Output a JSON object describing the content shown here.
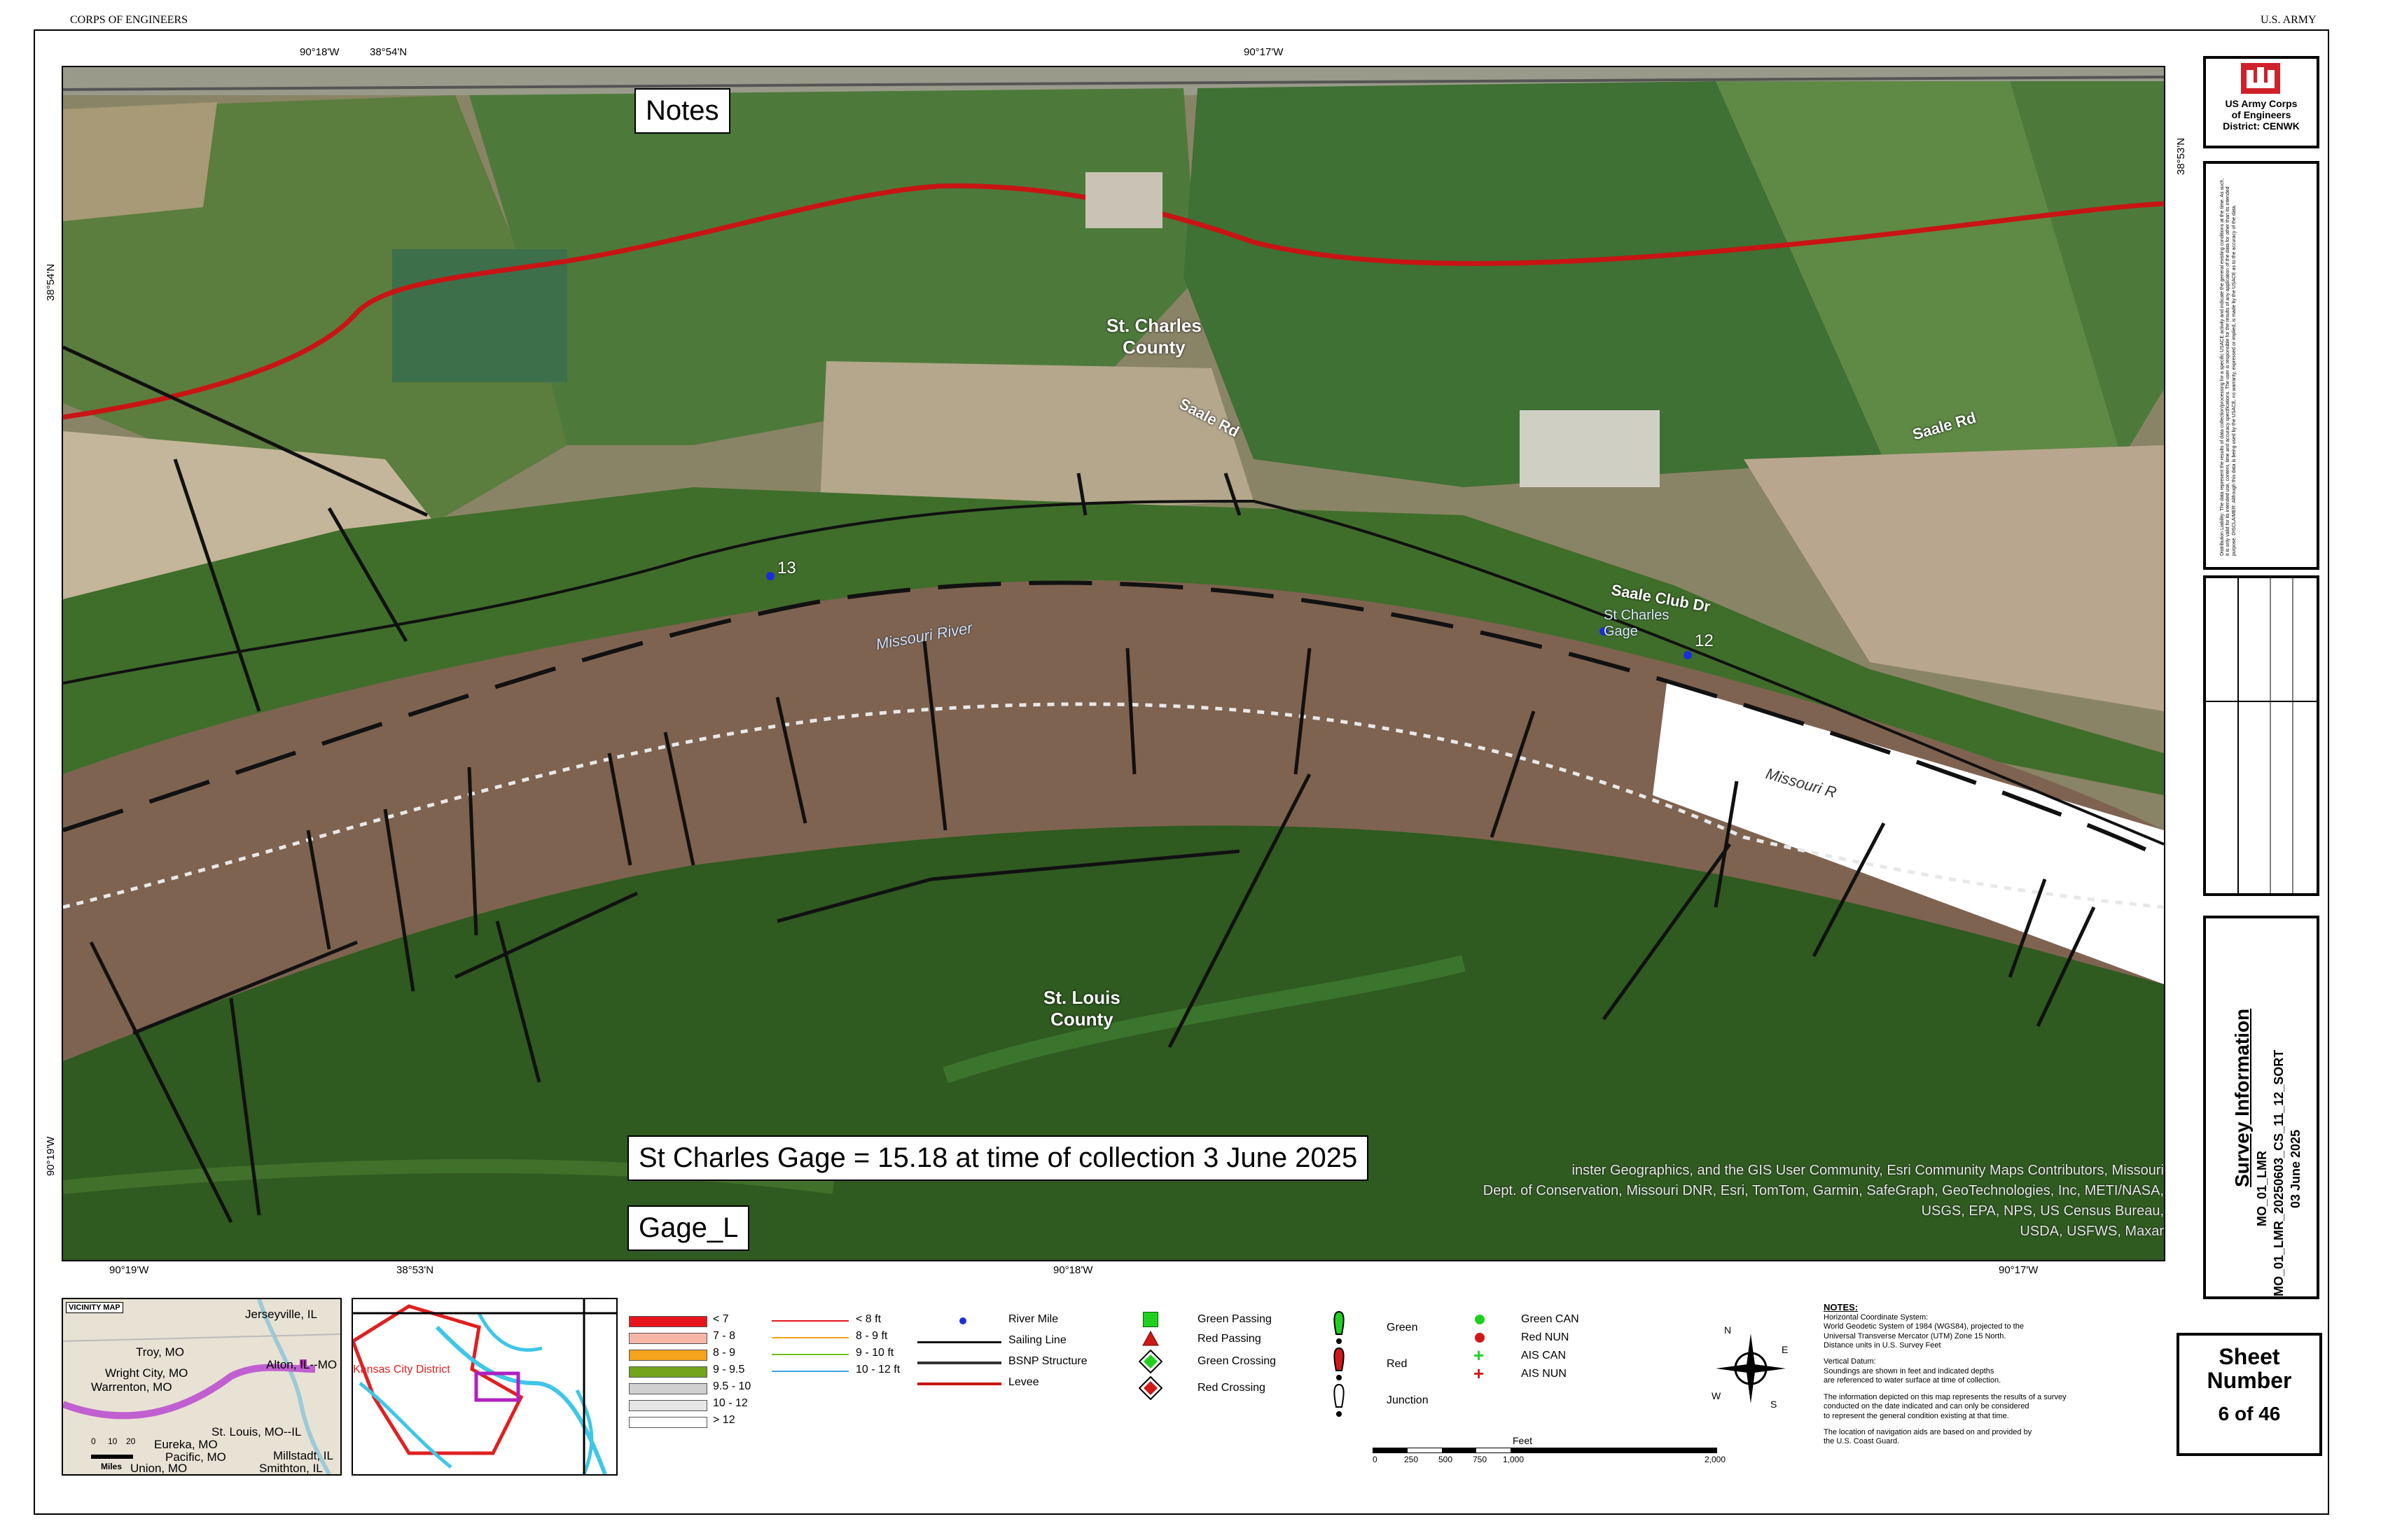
{
  "header": {
    "left": "CORPS OF ENGINEERS",
    "right": "U.S. ARMY"
  },
  "map": {
    "top_ticks": [
      "90°18'W",
      "38°54'N",
      "90°17'W"
    ],
    "bottom_ticks": [
      "90°19'W",
      "38°53'N",
      "90°18'W",
      "90°17'W"
    ],
    "left_ticks": [
      "38°54'N",
      "90°19'W"
    ],
    "right_ticks": [
      "38°53'N"
    ],
    "notes_box": "Notes",
    "gage_box": "St Charles Gage = 15.18 at time of collection 3 June 2025",
    "gage_layer": "Gage_L",
    "labels": {
      "st_charles_county": "St. Charles\nCounty",
      "st_louis_county": "St. Louis\nCounty",
      "missouri_river": "Missouri River",
      "missouri_river_2": "Missouri R",
      "saale_rd_1": "Saale Rd",
      "saale_rd_2": "Saale Rd",
      "saale_club_dr": "Saale Club Dr",
      "st_charles_gage": "St Charles\nGage",
      "river_mile_13": "13",
      "river_mile_12": "12"
    },
    "attribution": "Esri Community Maps Contributors, Missouri Dept. of Conservation, Missouri DNR, Esri, TomTom, Garmin, SafeGraph, GeoTechnologies, Inc, METI/NASA, USGS, EPA, NPS, US Census Bureau, USDA, USFWS, Maxar",
    "attribution_lines": [
      "inster Geographics, and the GIS User Community, Esri Community Maps Contributors, Missouri",
      "Dept. of Conservation, Missouri DNR, Esri, TomTom, Garmin, SafeGraph, GeoTechnologies, Inc, METI/NASA, USGS, EPA, NPS, US Census Bureau,",
      "USDA, USFWS, Maxar"
    ]
  },
  "title_block": {
    "org_lines": [
      "US Army Corps",
      "of Engineers",
      "District: CENWK"
    ],
    "disclaimer": "Distribution Liability: The data represent the results of data collection/processing for a specific USACE activity and indicate the general existing conditions at the time. As such, it is only valid for its intended use, content, time and accuracy specifications. The user is responsible for the results of any application of the data for other than its intended purpose. DISCLAIMER: Although this data is being used by the USACE, no warranty, expressed or implied, is made by the USACE as to the accuracy of the data.",
    "survey_info_title": "Survey Information",
    "survey_info_lines": [
      "MO_01_LMR",
      "MO_01_LMR_20250603_CS_11_12_SORT",
      "03 June 2025"
    ],
    "sheet_label": "Sheet\nNumber",
    "sheet_value": "6 of 46"
  },
  "inset_vicinity": {
    "title": "VICINITY MAP",
    "places": [
      "Jerseyville, IL",
      "Troy, MO",
      "Alton, IL--MO",
      "Wright City, MO",
      "Warrenton, MO",
      "St. Louis, MO--IL",
      "Eureka, MO",
      "Pacific, MO",
      "Union, MO",
      "Millstadt, IL",
      "Smithton, IL"
    ],
    "scale_ticks": [
      "0",
      "10",
      "20"
    ],
    "scale_unit": "Miles"
  },
  "inset_district": {
    "label": "Kansas City District"
  },
  "legend": {
    "depth": [
      {
        "label": "< 7",
        "color": "#e8141c"
      },
      {
        "label": "7 - 8",
        "color": "#f6b5a6"
      },
      {
        "label": "8 - 9",
        "color": "#f5a21c"
      },
      {
        "label": "9 - 9.5",
        "color": "#72a51c"
      },
      {
        "label": "9.5 - 10",
        "color": "#cfcfcf"
      },
      {
        "label": "10 - 12",
        "color": "#e6e6e6"
      },
      {
        "label": "> 12",
        "color": "#ffffff"
      }
    ],
    "contours": [
      {
        "label": "< 8 ft",
        "color": "#e8141c"
      },
      {
        "label": "8 - 9 ft",
        "color": "#f5a21c"
      },
      {
        "label": "9 - 10 ft",
        "color": "#72c21c"
      },
      {
        "label": "10 - 12 ft",
        "color": "#3fa6e6"
      }
    ],
    "lines": [
      {
        "label": "River Mile",
        "kind": "dot"
      },
      {
        "label": "Sailing Line",
        "kind": "black"
      },
      {
        "label": "BSNP Structure",
        "kind": "black2"
      },
      {
        "label": "Levee",
        "kind": "red"
      }
    ],
    "nav_aids": [
      "Green Passing",
      "Red Passing",
      "Green Crossing",
      "Red Crossing"
    ],
    "buoys": [
      "Green",
      "Red",
      "Junction"
    ],
    "can_nun": [
      "Green CAN",
      "Red NUN",
      "AIS CAN",
      "AIS NUN"
    ]
  },
  "scale_bar": {
    "unit": "Feet",
    "ticks": [
      "0",
      "250",
      "500",
      "750",
      "1,000",
      "2,000"
    ]
  },
  "notes": {
    "title": "NOTES:",
    "lines": [
      "Horizontal Coordinate System:",
      "World Geodetic System of 1984 (WGS84), projected to the",
      "Universal Transverse Mercator (UTM) Zone 15 North.",
      "Distance units in U.S. Survey Feet",
      "",
      "Vertical Datum:",
      "Soundings are shown in feet and indicated depths",
      "are referenced to water surface at time of collection.",
      "",
      "The information depicted on this map represents the results of a survey",
      "conducted on the date indicated and can only be considered",
      "to represent the general condition existing at that time.",
      "",
      "The location of navigation aids are based on and provided by",
      "the U.S. Coast Guard."
    ]
  },
  "compass": {
    "n": "N",
    "s": "S",
    "e": "E",
    "w": "W"
  }
}
